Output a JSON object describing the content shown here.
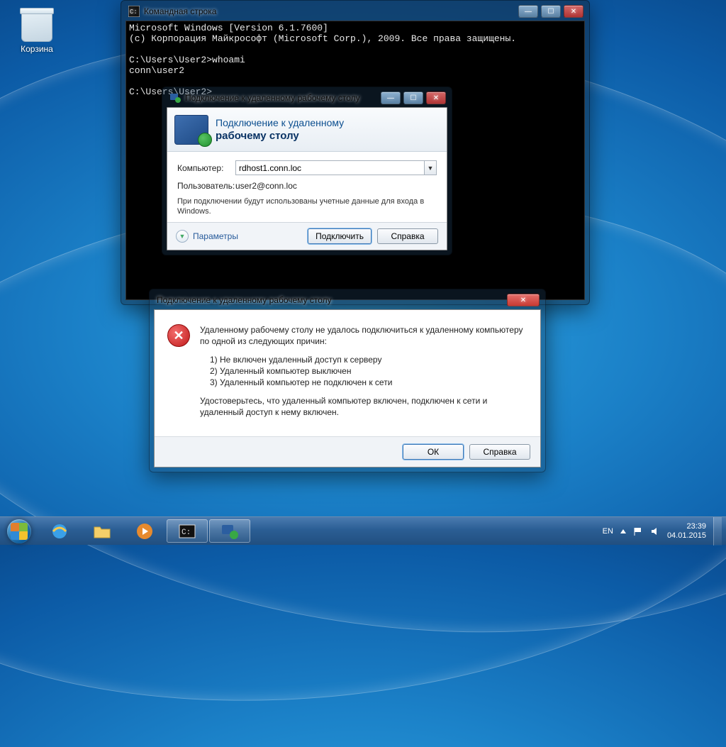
{
  "desktop": {
    "recycle_label": "Корзина"
  },
  "cmd": {
    "title": "Командная строка",
    "lines": "Microsoft Windows [Version 6.1.7600]\n(c) Корпорация Майкрософт (Microsoft Corp.), 2009. Все права защищены.\n\nC:\\Users\\User2>whoami\nconn\\user2\n\nC:\\Users\\User2>"
  },
  "rdp": {
    "title": "Подключение к удаленному рабочему столу",
    "banner_line1": "Подключение к удаленному",
    "banner_line2": "рабочему столу",
    "computer_label": "Компьютер:",
    "computer_value": "rdhost1.conn.loc",
    "user_label": "Пользователь:",
    "user_value": "user2@conn.loc",
    "hint": "При подключении будут использованы учетные данные для входа в Windows.",
    "params": "Параметры",
    "connect": "Подключить",
    "help": "Справка"
  },
  "err": {
    "title": "Подключение к удаленному рабочему столу",
    "msg": "Удаленному рабочему столу не удалось подключиться к удаленному компьютеру по одной из следующих причин:",
    "r1": "1) Не включен удаленный доступ к серверу",
    "r2": "2) Удаленный компьютер выключен",
    "r3": "3) Удаленный компьютер не подключен к сети",
    "advice": "Удостоверьтесь, что удаленный компьютер включен, подключен к сети и удаленный доступ к нему включен.",
    "ok": "ОК",
    "help": "Справка"
  },
  "taskbar": {
    "lang": "EN",
    "time": "23:39",
    "date": "04.01.2015"
  }
}
